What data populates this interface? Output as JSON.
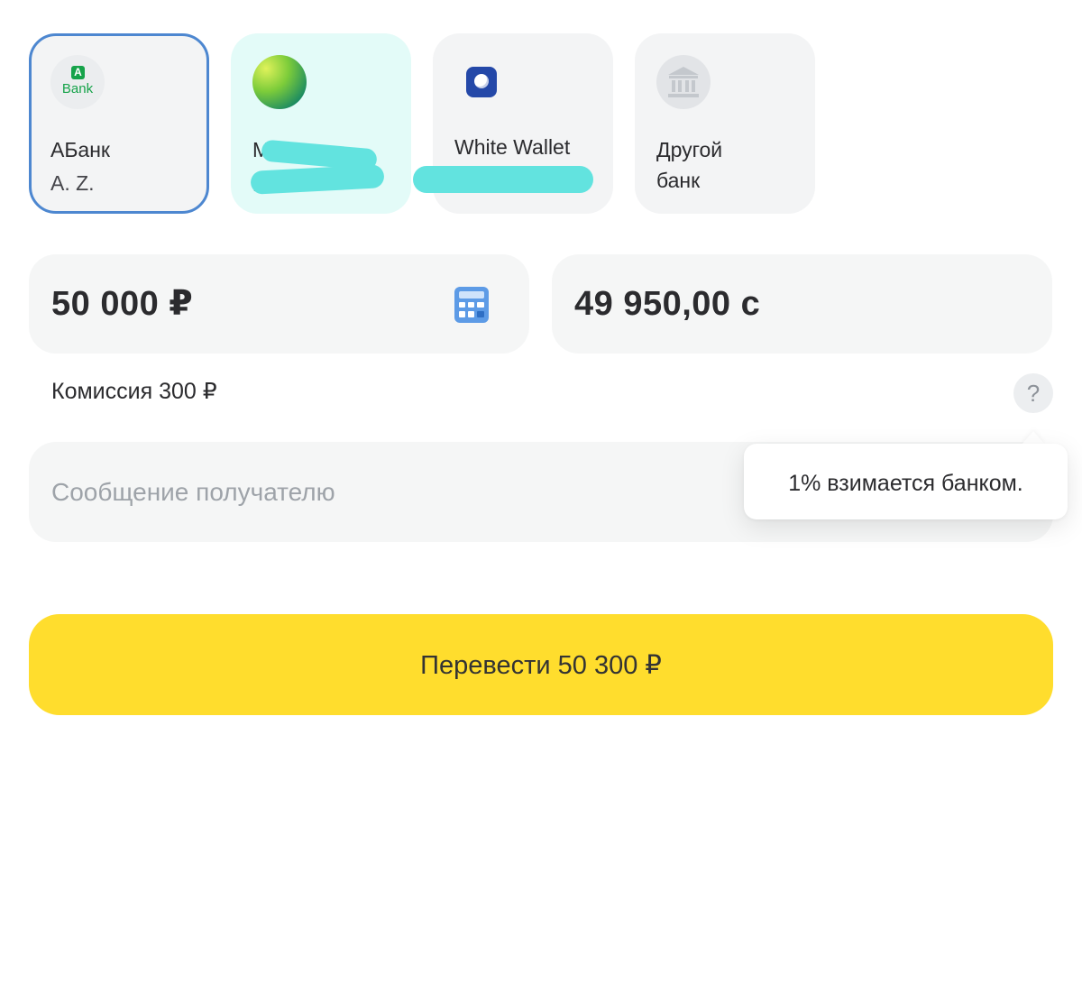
{
  "banks": [
    {
      "title": "АБанк",
      "subtitle": "А. Z.",
      "logo_text": "Bank",
      "logo_badge": "A",
      "icon": "abank-logo-icon",
      "selected": true
    },
    {
      "title": "МР",
      "subtitle": "М",
      "icon": "green-sphere-logo-icon",
      "selected": false
    },
    {
      "title": "White Wallet",
      "icon": "white-wallet-logo-icon",
      "selected": false
    },
    {
      "title": "Другой",
      "subtitle": "банк",
      "icon": "bank-building-icon",
      "selected": false
    }
  ],
  "transfer": {
    "amount_from": "50 000 ₽",
    "amount_to": "49 950,00 с",
    "commission": "Комиссия 300 ₽",
    "help_label": "?",
    "tooltip": "1% взимается банком.",
    "message_placeholder": "Сообщение получателю",
    "message_value": "",
    "submit_label": "Перевести 50 300 ₽"
  },
  "colors": {
    "accent_yellow": "#ffdd2d",
    "selected_border": "#4d87d0",
    "field_bg": "#f5f6f6"
  }
}
